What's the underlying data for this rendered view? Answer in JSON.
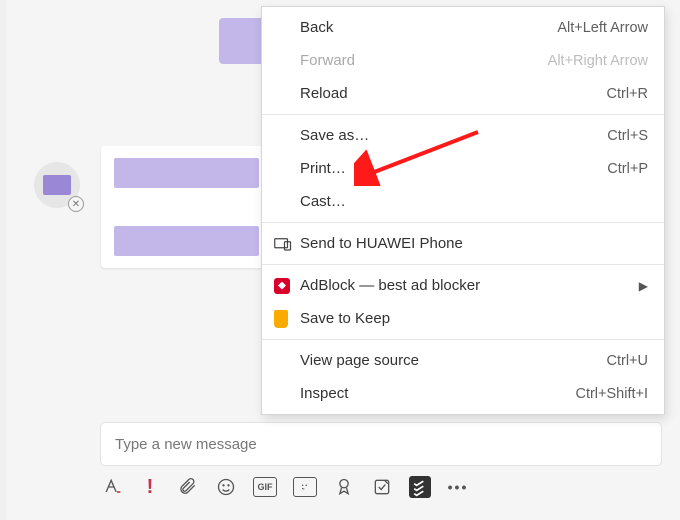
{
  "colors": {
    "redact": "#c2b7e8",
    "arrow": "#ff1a1a"
  },
  "compose": {
    "placeholder": "Type a new message"
  },
  "toolbar": {
    "format": "Format",
    "priority": "Set delivery options",
    "attach": "Attach",
    "emoji": "Emoji",
    "gif": "GIF",
    "sticker": "Sticker",
    "praise": "Praise",
    "approvals": "Approvals",
    "todoist": "Todoist",
    "more": "More"
  },
  "menu": {
    "back": {
      "label": "Back",
      "shortcut": "Alt+Left Arrow"
    },
    "forward": {
      "label": "Forward",
      "shortcut": "Alt+Right Arrow"
    },
    "reload": {
      "label": "Reload",
      "shortcut": "Ctrl+R"
    },
    "saveas": {
      "label": "Save as…",
      "shortcut": "Ctrl+S"
    },
    "print": {
      "label": "Print…",
      "shortcut": "Ctrl+P"
    },
    "cast": {
      "label": "Cast…",
      "shortcut": ""
    },
    "huawei": {
      "label": "Send to HUAWEI Phone",
      "shortcut": ""
    },
    "adblock": {
      "label": "AdBlock — best ad blocker",
      "shortcut": ""
    },
    "keep": {
      "label": "Save to Keep",
      "shortcut": ""
    },
    "source": {
      "label": "View page source",
      "shortcut": "Ctrl+U"
    },
    "inspect": {
      "label": "Inspect",
      "shortcut": "Ctrl+Shift+I"
    }
  }
}
